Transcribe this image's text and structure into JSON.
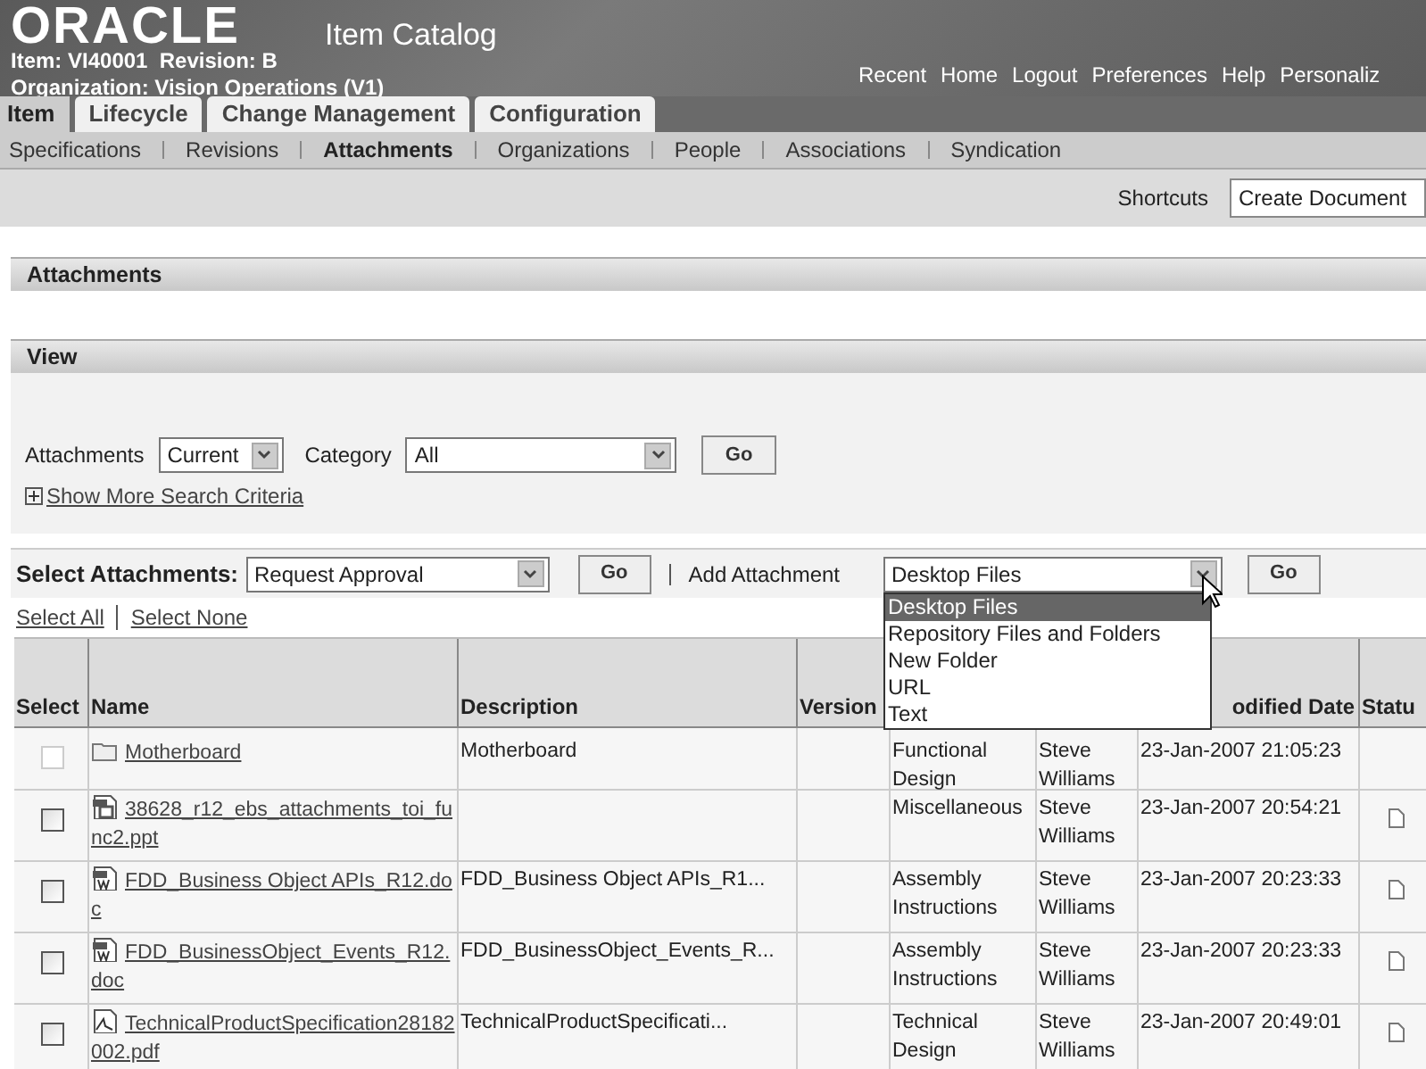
{
  "header": {
    "logo": "ORACLE",
    "app_title": "Item Catalog",
    "item_line": "Item: VI40001  Revision: B",
    "org_line": "Organization: Vision Operations (V1)",
    "global_links": [
      "Recent",
      "Home",
      "Logout",
      "Preferences",
      "Help",
      "Personaliz"
    ]
  },
  "tabs": [
    {
      "label": "Item",
      "selected": true
    },
    {
      "label": "Lifecycle",
      "selected": false
    },
    {
      "label": "Change Management",
      "selected": false
    },
    {
      "label": "Configuration",
      "selected": false
    }
  ],
  "subtabs": [
    {
      "label": "Specifications",
      "selected": false
    },
    {
      "label": "Revisions",
      "selected": false
    },
    {
      "label": "Attachments",
      "selected": true
    },
    {
      "label": "Organizations",
      "selected": false
    },
    {
      "label": "People",
      "selected": false
    },
    {
      "label": "Associations",
      "selected": false
    },
    {
      "label": "Syndication",
      "selected": false
    }
  ],
  "shortcuts": {
    "label": "Shortcuts",
    "value": "Create Document"
  },
  "page_title": "Attachments",
  "view": {
    "title": "View",
    "attachments_label": "Attachments",
    "attachments_value": "Current",
    "category_label": "Category",
    "category_value": "All",
    "go": "Go",
    "more_criteria": "Show More Search Criteria"
  },
  "actions": {
    "select_label": "Select Attachments:",
    "select_value": "Request Approval",
    "go": "Go",
    "add_label": "Add Attachment",
    "add_value": "Desktop Files",
    "add_go": "Go",
    "add_options": [
      {
        "label": "Desktop Files",
        "selected": true
      },
      {
        "label": "Repository Files and Folders",
        "selected": false
      },
      {
        "label": "New Folder",
        "selected": false
      },
      {
        "label": "URL",
        "selected": false
      },
      {
        "label": "Text",
        "selected": false
      }
    ]
  },
  "select_all": "Select All",
  "select_none": "Select None",
  "table": {
    "columns": [
      "Select",
      "Name",
      "Description",
      "Version",
      "",
      "",
      "odified Date",
      "Statu"
    ],
    "rows": [
      {
        "kind": "folder",
        "disabled": true,
        "name": "Motherboard",
        "description": "Motherboard",
        "version": "",
        "category": "Functional Design",
        "author": "Steve Williams",
        "date": "23-Jan-2007 21:05:23",
        "status_icon": false
      },
      {
        "kind": "ppt",
        "disabled": false,
        "name": "38628_r12_ebs_attachments_toi_func2.ppt",
        "description": "",
        "version": "",
        "category": "Miscellaneous",
        "author": "Steve Williams",
        "date": "23-Jan-2007 20:54:21",
        "status_icon": true
      },
      {
        "kind": "doc",
        "disabled": false,
        "name": "FDD_Business Object APIs_R12.doc",
        "description": "FDD_Business Object APIs_R1...",
        "version": "",
        "category": "Assembly Instructions",
        "author": "Steve Williams",
        "date": "23-Jan-2007 20:23:33",
        "status_icon": true
      },
      {
        "kind": "doc",
        "disabled": false,
        "name": "FDD_BusinessObject_Events_R12.doc",
        "description": "FDD_BusinessObject_Events_R...",
        "version": "",
        "category": "Assembly Instructions",
        "author": "Steve Williams",
        "date": "23-Jan-2007 20:23:33",
        "status_icon": true
      },
      {
        "kind": "pdf",
        "disabled": false,
        "name": "TechnicalProductSpecification28182002.pdf",
        "description": "TechnicalProductSpecificati...",
        "version": "",
        "category": "Technical Design",
        "author": "Steve Williams",
        "date": "23-Jan-2007 20:49:01",
        "status_icon": true
      }
    ]
  }
}
